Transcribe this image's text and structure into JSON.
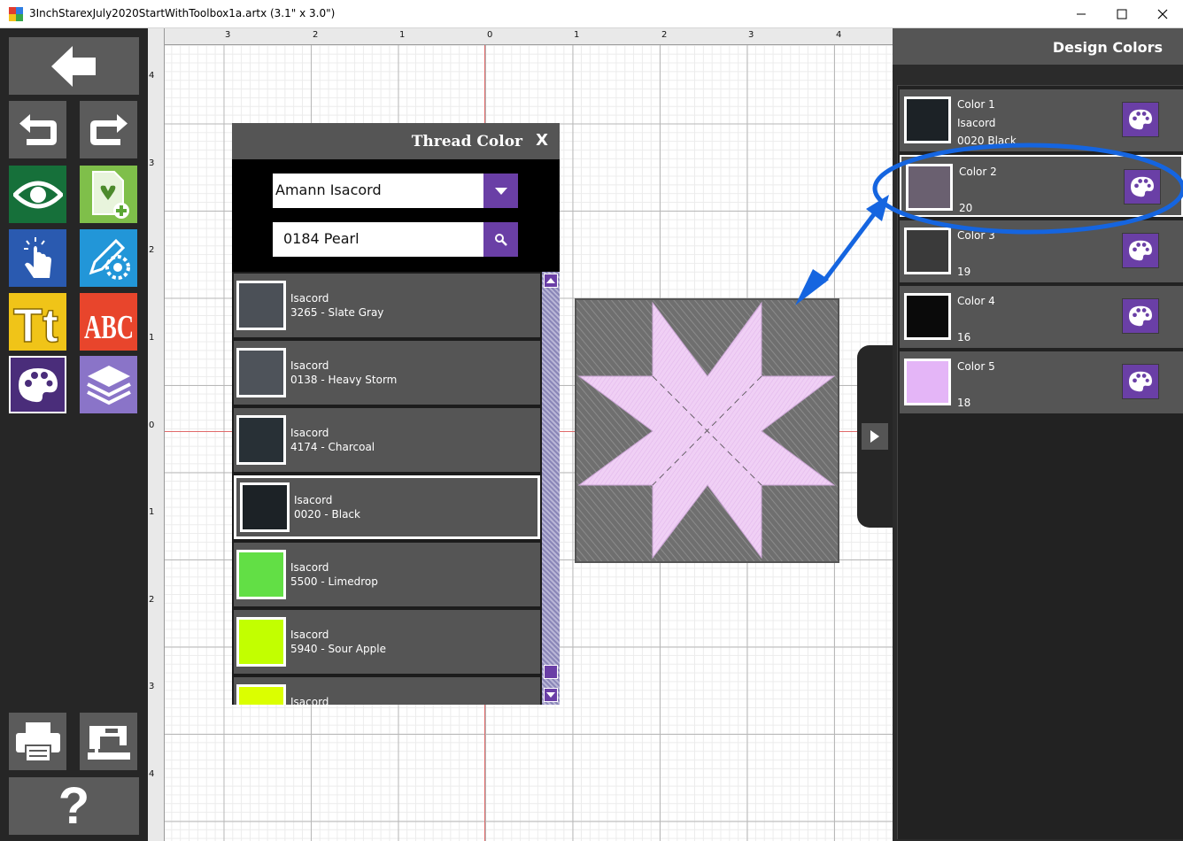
{
  "window": {
    "title": "3InchStarexJuly2020StartWithToolbox1a.artx (3.1\" x 3.0\")",
    "minimize": "—",
    "maximize": "☐",
    "close": "✕"
  },
  "rulers": {
    "top": [
      "3",
      "2",
      "1",
      "0",
      "1",
      "2",
      "3",
      "4"
    ],
    "left": [
      "4",
      "3",
      "2",
      "1",
      "0",
      "1",
      "2",
      "3",
      "4"
    ]
  },
  "thread_dialog": {
    "title": "Thread Color",
    "close": "X",
    "brand": "Amann Isacord",
    "search_value": "0184 Pearl",
    "items": [
      {
        "brand": "Isacord",
        "name": "3265 - Slate Gray",
        "color": "#4b5057"
      },
      {
        "brand": "Isacord",
        "name": "0138 - Heavy Storm",
        "color": "#4e535a"
      },
      {
        "brand": "Isacord",
        "name": "4174 - Charcoal",
        "color": "#283036"
      },
      {
        "brand": "Isacord",
        "name": "0020 - Black",
        "color": "#1c2226",
        "selected": true
      },
      {
        "brand": "Isacord",
        "name": "5500 - Limedrop",
        "color": "#62df45"
      },
      {
        "brand": "Isacord",
        "name": "5940 - Sour Apple",
        "color": "#c2ff00"
      },
      {
        "brand": "Isacord",
        "name": "",
        "color": "#dbff00"
      }
    ]
  },
  "design_colors": {
    "title": "Design Colors",
    "items": [
      {
        "label": "Color 1",
        "line2": "Isacord",
        "line3": "0020 Black",
        "color": "#1c2226"
      },
      {
        "label": "Color 2",
        "line2": "",
        "line3": "20",
        "color": "#6a6070",
        "selected": true
      },
      {
        "label": "Color 3",
        "line2": "",
        "line3": "19",
        "color": "#3a3a3a"
      },
      {
        "label": "Color 4",
        "line2": "",
        "line3": "16",
        "color": "#0a0a0a"
      },
      {
        "label": "Color 5",
        "line2": "",
        "line3": "18",
        "color": "#e4b5f7"
      }
    ]
  },
  "toolbar": {
    "help_label": "?"
  },
  "colors": {
    "accent_purple": "#6a3fa6",
    "annotation_blue": "#1565e0",
    "design_pink": "#f0d0f5",
    "design_gray": "#6f6f6f"
  }
}
